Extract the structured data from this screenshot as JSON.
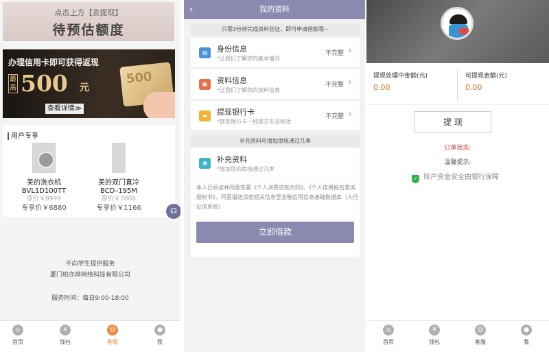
{
  "screen1": {
    "banner_top": {
      "sub": "点击上方【去提现】",
      "big": "待预估额度"
    },
    "promo": {
      "line1": "办理信用卡即可获得返现",
      "badge": "最高",
      "amount": "500",
      "unit": "元",
      "button": "查看详情≫",
      "card_text": "500"
    },
    "exclusive": {
      "title": "用户专享",
      "products": [
        {
          "name1": "美的洗衣机",
          "name2": "BVL1D100TT",
          "original": "原价￥8999",
          "price": "专享价￥6880"
        },
        {
          "name1": "美的双门直冷",
          "name2": "BCD–195M",
          "original": "原价￥3808",
          "price": "专享价￥1166"
        }
      ]
    },
    "float_icon": "headset-icon",
    "footer": {
      "line1": "不向学生提供服务",
      "line2": "厦门柏亦烨网络科技有限公司",
      "hours": "服务时间：每日9:00-18:00"
    },
    "tabs": [
      {
        "label": "首页",
        "icon": "home-icon"
      },
      {
        "label": "钱包",
        "icon": "wallet-icon"
      },
      {
        "label": "客服",
        "icon": "service-icon"
      },
      {
        "label": "我",
        "icon": "user-icon"
      }
    ]
  },
  "screen2": {
    "title": "我的资料",
    "tip": "只需3分钟完成资料验证，即可申请借款哦~",
    "items": [
      {
        "title": "身份信息",
        "desc": "*让我们了解您的基本情况",
        "status": "不完整",
        "color": "#4a90d9"
      },
      {
        "title": "资料信息",
        "desc": "*让我们了解您的资料信息",
        "status": "不完整",
        "color": "#e2704a"
      },
      {
        "title": "提现银行卡",
        "desc": "*提现银行卡一经提交无法修改",
        "status": "不完整",
        "color": "#f2b232"
      }
    ],
    "separator": "补充资料可增加审核通过几率",
    "extra": {
      "title": "补充资料",
      "desc": "*增加您的审核通过几率",
      "color": "#3ab6c8"
    },
    "agreement": "本人已阅读并同意签署《个人消费贷款合同》、《个人信用报告查询授权书》，同意报送贷款相关信息至金融信用信息基础数据库（人行征信系统）",
    "button": "立即借款"
  },
  "screen3": {
    "processing_label": "提现处理中金额(元)",
    "processing_value": "0.00",
    "available_label": "可提现金额(元)",
    "available_value": "0.00",
    "withdraw_button": "提 现",
    "order_status": "订单状态:",
    "tip": "温馨提示:",
    "safety": "账户资金安全由银行保障",
    "tabs": [
      {
        "label": "首页",
        "icon": "home-icon"
      },
      {
        "label": "钱包",
        "icon": "wallet-icon"
      },
      {
        "label": "客服",
        "icon": "service-icon"
      },
      {
        "label": "我",
        "icon": "user-icon"
      }
    ]
  }
}
